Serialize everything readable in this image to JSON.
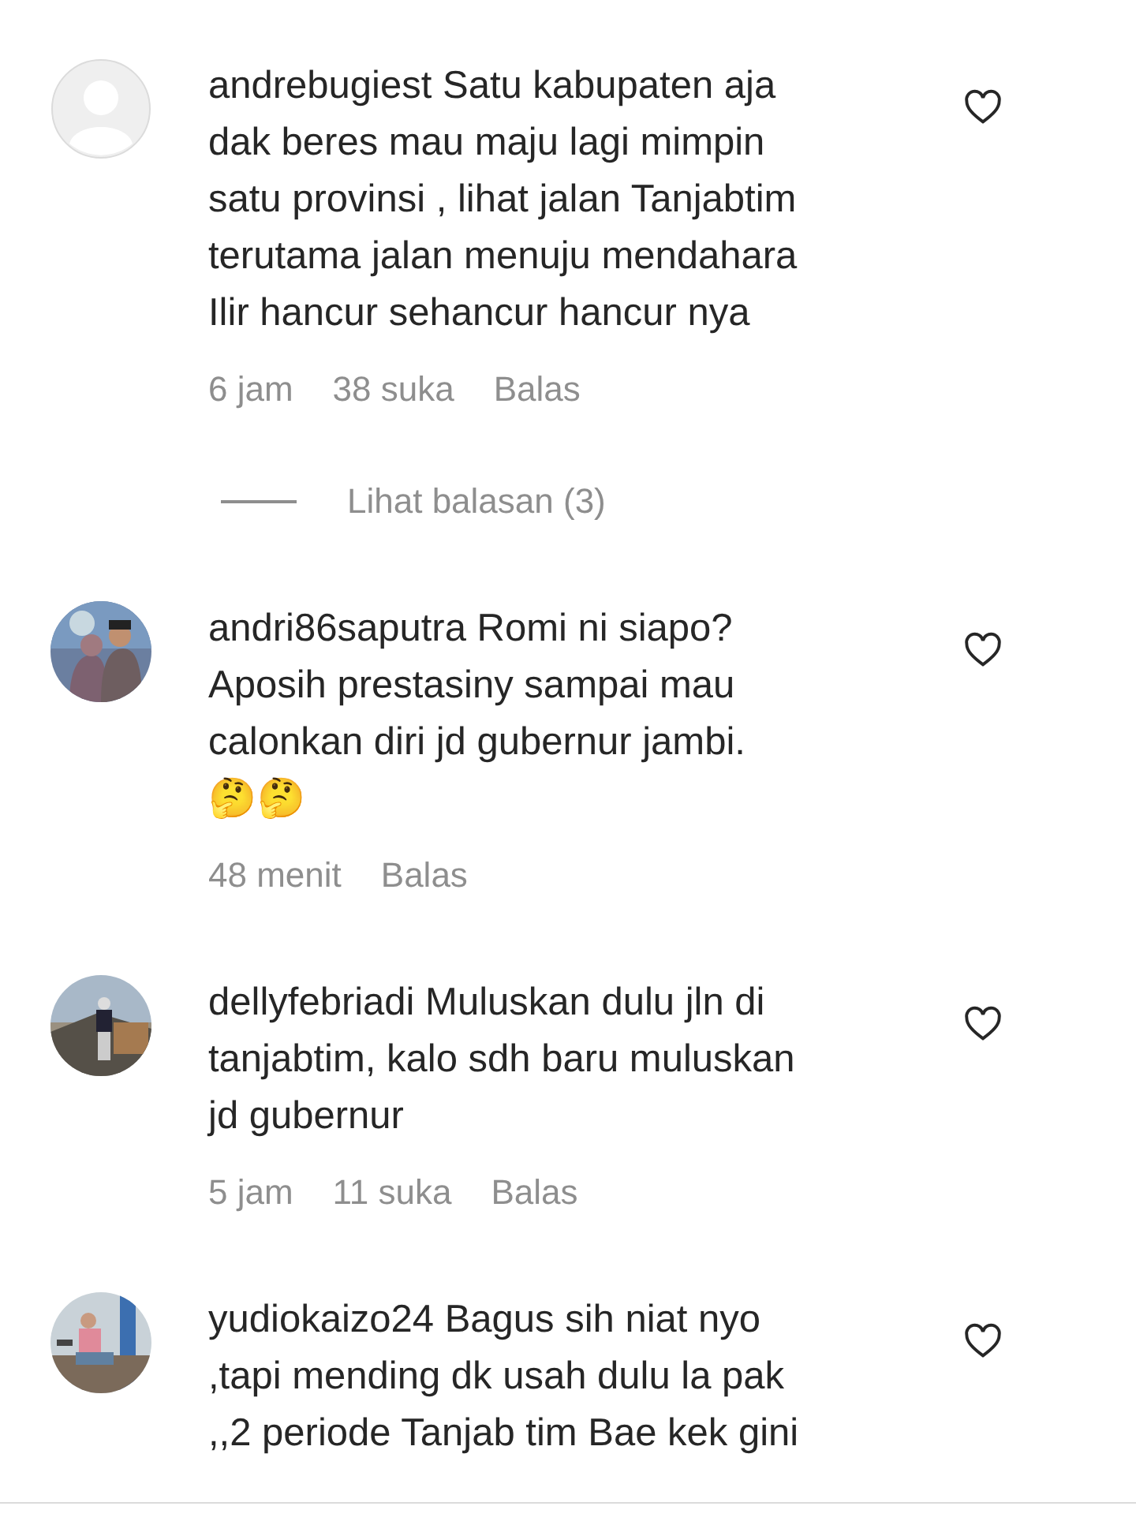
{
  "comments": [
    {
      "avatar": {
        "kind": "default"
      },
      "lines": [
        "andrebugiest Satu kabupaten aja",
        "dak beres mau maju lagi mimpin",
        "satu provinsi , lihat jalan Tanjabtim",
        "terutama jalan menuju mendahara",
        "Ilir hancur sehancur hancur nya"
      ],
      "liked": false,
      "time": "6 jam",
      "likes": "38 suka",
      "reply": "Balas",
      "replies_link": "Lihat balasan (3)"
    },
    {
      "avatar": {
        "kind": "picture"
      },
      "lines": [
        "andri86saputra Romi ni siapo?",
        "Aposih prestasiny sampai mau",
        "calonkan diri jd gubernur jambi.",
        "🤔🤔"
      ],
      "liked": false,
      "time": "48 menit",
      "reply": "Balas"
    },
    {
      "avatar": {
        "kind": "picture"
      },
      "lines": [
        "dellyfebriadi Muluskan dulu jln di",
        "tanjabtim, kalo sdh baru muluskan",
        "jd gubernur"
      ],
      "liked": false,
      "time": "5 jam",
      "likes": "11 suka",
      "reply": "Balas"
    },
    {
      "avatar": {
        "kind": "picture"
      },
      "lines": [
        "yudiokaizo24 Bagus sih niat nyo",
        ",tapi mending dk usah dulu la pak",
        ",,2 periode Tanjab tim Bae kek gini"
      ],
      "liked": false
    }
  ]
}
